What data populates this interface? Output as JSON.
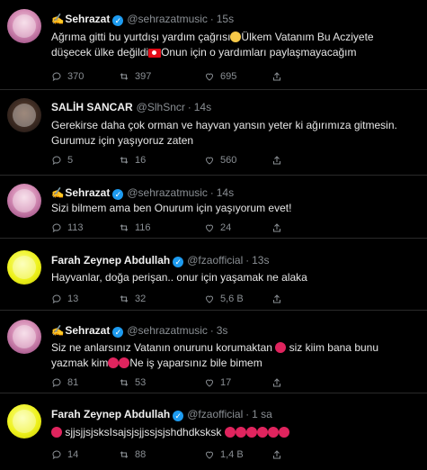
{
  "tweets": [
    {
      "name": "Sehrazat",
      "handle": "@sehrazatmusic",
      "time": "15s",
      "text_parts": [
        "Ağrıma gitti bu yurtdışı yardım çağrısı",
        "Ülkem Vatanım Bu Acziyete düşecek ülke değildi",
        "Onun için o yardımları paylaşmayacağım"
      ],
      "replies": "370",
      "retweets": "397",
      "likes": "695"
    },
    {
      "name": "SALİH SANCAR",
      "handle": "@SlhSncr",
      "time": "14s",
      "text": "Gerekirse daha çok orman ve hayvan yansın yeter ki ağırımıza gitmesin. Gurumuz için yaşıyoruz zaten",
      "replies": "5",
      "retweets": "16",
      "likes": "560"
    },
    {
      "name": "Sehrazat",
      "handle": "@sehrazatmusic",
      "time": "14s",
      "text": "Sizi bilmem ama ben Onurum için yaşıyorum evet!",
      "replies": "113",
      "retweets": "116",
      "likes": "24"
    },
    {
      "name": "Farah Zeynep Abdullah",
      "handle": "@fzaofficial",
      "time": "13s",
      "text": "Hayvanlar, doğa perişan.. onur için yaşamak ne alaka",
      "replies": "13",
      "retweets": "32",
      "likes": "5,6 B"
    },
    {
      "name": "Sehrazat",
      "handle": "@sehrazatmusic",
      "time": "3s",
      "text_parts": [
        "Siz ne anlarsınız Vatanın onurunu korumaktan",
        "siz kiim bana bunu yazmak kim",
        "Ne iş yaparsınız bile bimem"
      ],
      "replies": "81",
      "retweets": "53",
      "likes": "17"
    },
    {
      "name": "Farah Zeynep Abdullah",
      "handle": "@fzaofficial",
      "time": "1 sa",
      "text": "sjjsjjsjsksIsajsjsjjssjsjshdhdksksk",
      "replies": "14",
      "retweets": "88",
      "likes": "1,4 B"
    }
  ],
  "colors": {
    "background": "#000000",
    "verified": "#1d9bf0",
    "muted": "#8a8f94"
  },
  "icons": [
    "reply-icon",
    "retweet-icon",
    "like-icon",
    "share-icon",
    "verified-icon",
    "quill-emoji",
    "angry-emoji",
    "sad-emoji",
    "turkey-flag-emoji"
  ]
}
